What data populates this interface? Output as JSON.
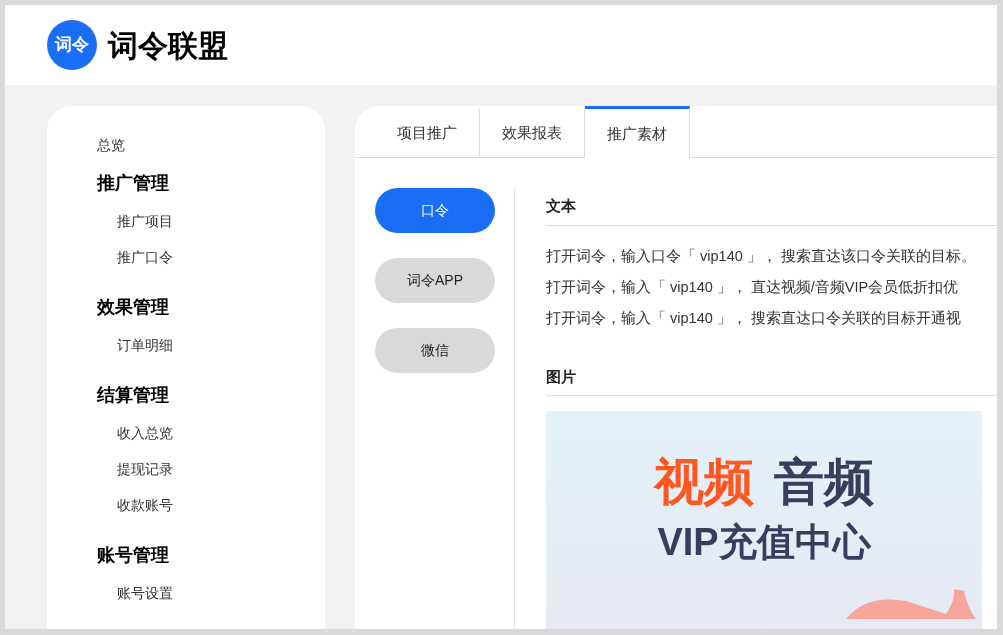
{
  "header": {
    "logo_mark": "词令",
    "title": "词令联盟"
  },
  "sidebar": {
    "overview": "总览",
    "groups": [
      {
        "title": "推广管理",
        "items": [
          "推广项目",
          "推广口令"
        ]
      },
      {
        "title": "效果管理",
        "items": [
          "订单明细"
        ]
      },
      {
        "title": "结算管理",
        "items": [
          "收入总览",
          "提现记录",
          "收款账号"
        ]
      },
      {
        "title": "账号管理",
        "items": [
          "账号设置"
        ]
      }
    ]
  },
  "tabs": [
    {
      "label": "项目推广",
      "selected": false
    },
    {
      "label": "效果报表",
      "selected": false
    },
    {
      "label": "推广素材",
      "selected": true
    }
  ],
  "material_types": [
    {
      "label": "口令",
      "selected": true
    },
    {
      "label": "词令APP",
      "selected": false
    },
    {
      "label": "微信",
      "selected": false
    }
  ],
  "text_section": {
    "title": "文本",
    "lines": [
      "打开词令，输入口令「 vip140 」， 搜索直达该口令关联的目标。",
      "打开词令，输入「 vip140 」， 直达视频/音频VIP会员低折扣优",
      "打开词令，输入「 vip140 」， 搜索直达口令关联的目标开通视"
    ]
  },
  "image_section": {
    "title": "图片",
    "banner": {
      "word_1": "视频",
      "word_2": "音频",
      "subtitle": "VIP充值中心"
    }
  }
}
